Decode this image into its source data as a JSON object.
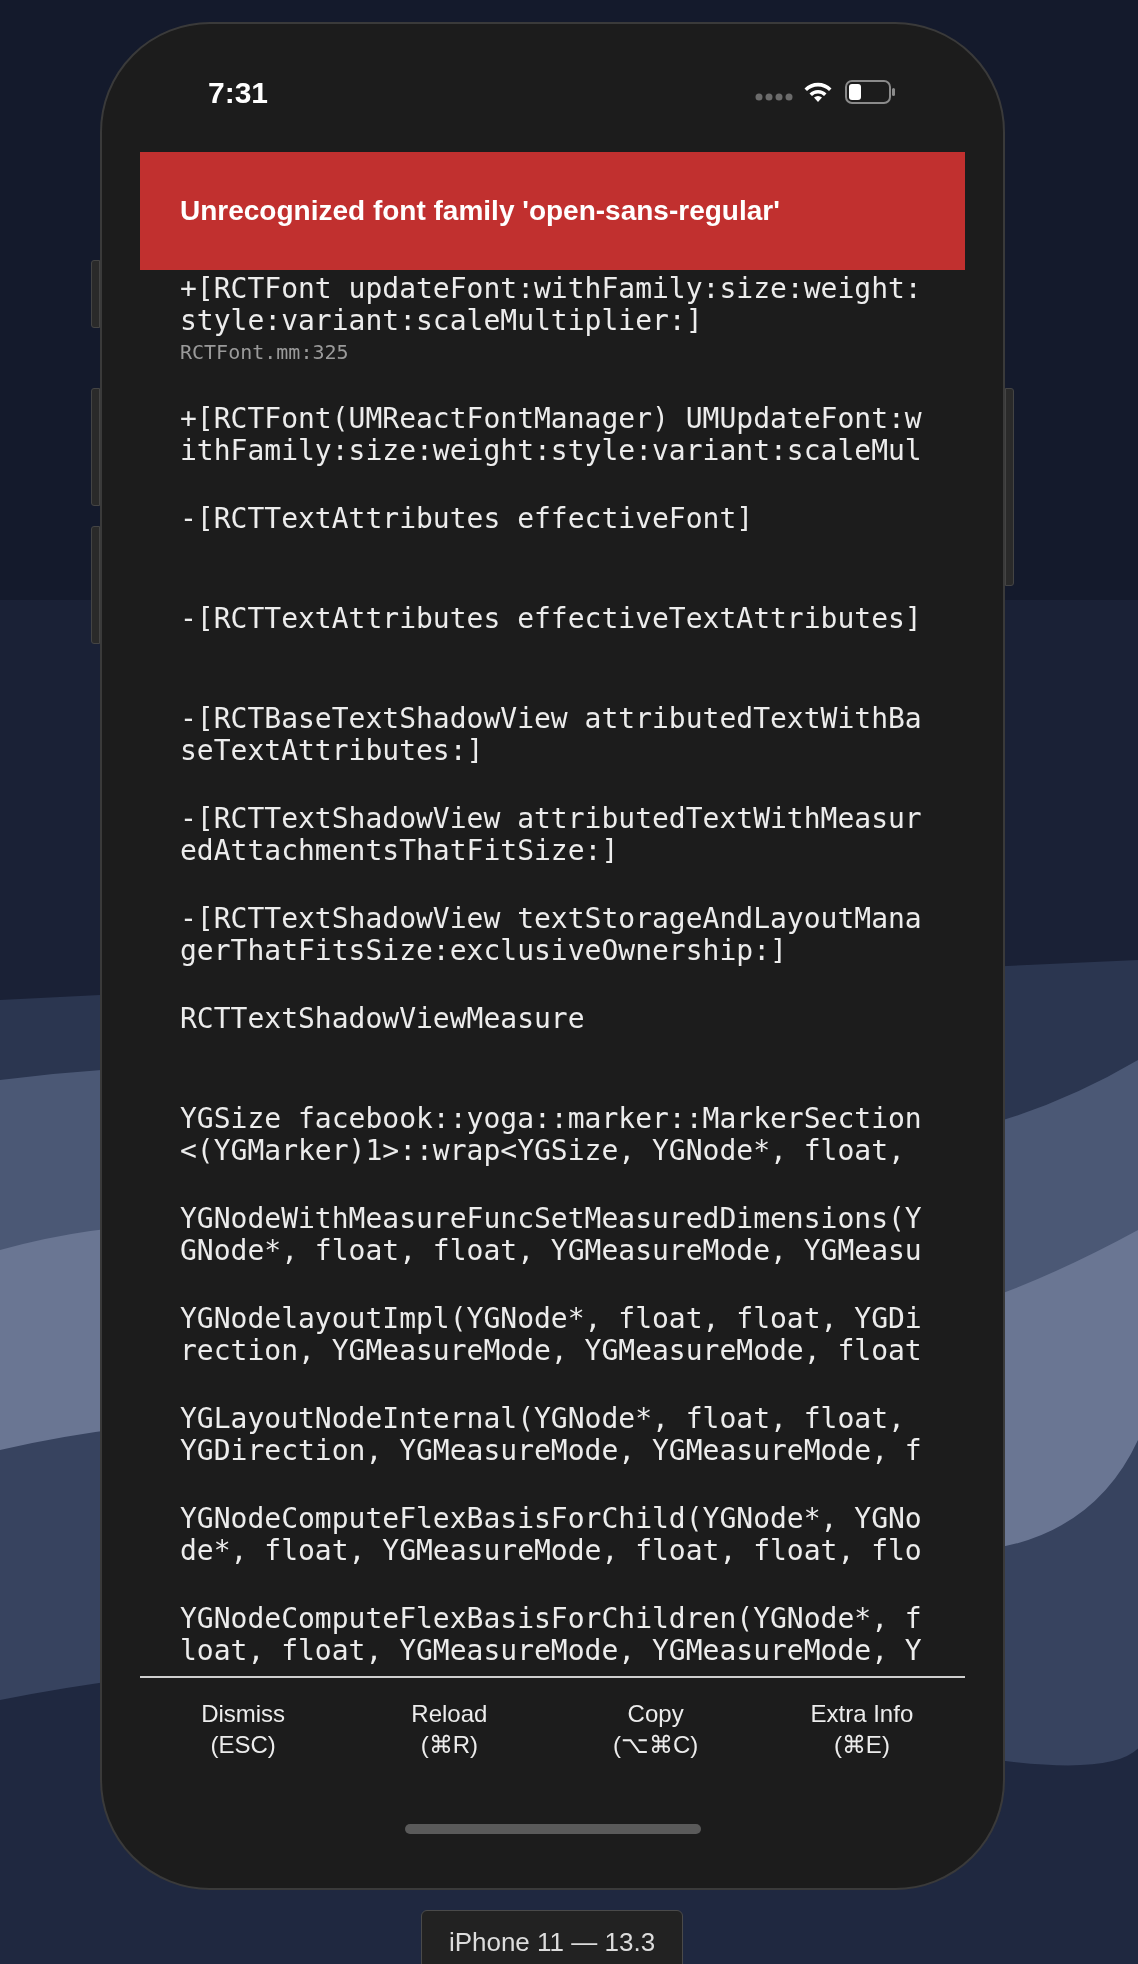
{
  "status_bar": {
    "time": "7:31"
  },
  "error": {
    "message": "Unrecognized font family 'open-sans-regular'"
  },
  "stack_frames": [
    {
      "lines": [
        "+[RCTFont updateFont:withFamily:size:weight:",
        "style:variant:scaleMultiplier:]"
      ],
      "file": "RCTFont.mm:325"
    },
    {
      "lines": [
        "+[RCTFont(UMReactFontManager) UMUpdateFont:w",
        "ithFamily:size:weight:style:variant:scaleMul"
      ]
    },
    {
      "lines": [
        "-[RCTTextAttributes effectiveFont]"
      ]
    },
    {
      "lines": [
        "-[RCTTextAttributes effectiveTextAttributes]"
      ]
    },
    {
      "lines": [
        "-[RCTBaseTextShadowView attributedTextWithBa",
        "seTextAttributes:]"
      ]
    },
    {
      "lines": [
        "-[RCTTextShadowView attributedTextWithMeasur",
        "edAttachmentsThatFitSize:]"
      ]
    },
    {
      "lines": [
        "-[RCTTextShadowView textStorageAndLayoutMana",
        "gerThatFitsSize:exclusiveOwnership:]"
      ]
    },
    {
      "lines": [
        "RCTTextShadowViewMeasure"
      ]
    },
    {
      "lines": [
        "YGSize facebook::yoga::marker::MarkerSection",
        "<(YGMarker)1>::wrap<YGSize, YGNode*, float,"
      ]
    },
    {
      "lines": [
        "YGNodeWithMeasureFuncSetMeasuredDimensions(Y",
        "GNode*, float, float, YGMeasureMode, YGMeasu"
      ]
    },
    {
      "lines": [
        "YGNodelayoutImpl(YGNode*, float, float, YGDi",
        "rection, YGMeasureMode, YGMeasureMode, float"
      ]
    },
    {
      "lines": [
        "YGLayoutNodeInternal(YGNode*, float, float,",
        "YGDirection, YGMeasureMode, YGMeasureMode, f"
      ]
    },
    {
      "lines": [
        "YGNodeComputeFlexBasisForChild(YGNode*, YGNo",
        "de*, float, YGMeasureMode, float, float, flo"
      ]
    },
    {
      "lines": [
        "YGNodeComputeFlexBasisForChildren(YGNode*, f",
        "loat, float, YGMeasureMode, YGMeasureMode, Y"
      ]
    }
  ],
  "buttons": [
    {
      "label": "Dismiss",
      "shortcut": "(ESC)"
    },
    {
      "label": "Reload",
      "shortcut": "(⌘R)"
    },
    {
      "label": "Copy",
      "shortcut": "(⌥⌘C)"
    },
    {
      "label": "Extra Info",
      "shortcut": "(⌘E)"
    }
  ],
  "device_label": "iPhone 11 — 13.3"
}
